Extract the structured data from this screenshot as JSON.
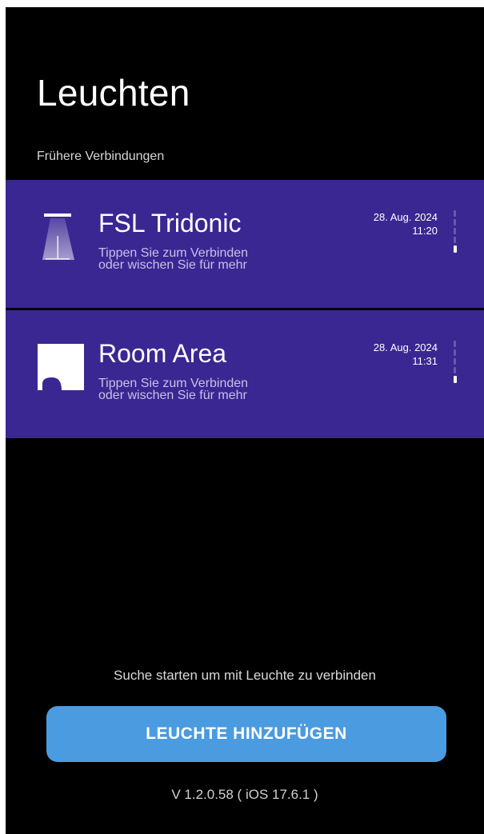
{
  "header": {
    "title": "Leuchten",
    "section_label": "Frühere Verbindungen"
  },
  "connections": [
    {
      "name": "FSL Tridonic",
      "icon": "ceiling-lamp-icon",
      "hint": "Tippen Sie zum Verbinden\noder wischen Sie für mehr",
      "date": "28. Aug. 2024",
      "time": "11:20"
    },
    {
      "name": "Room Area",
      "icon": "room-area-icon",
      "hint": "Tippen Sie zum Verbinden\noder wischen Sie für mehr",
      "date": "28. Aug. 2024",
      "time": "11:31"
    }
  ],
  "footer": {
    "search_hint": "Suche starten um mit Leuchte zu verbinden",
    "add_button_label": "LEUCHTE HINZUFÜGEN",
    "version": "V 1.2.0.58 ( iOS 17.6.1 )"
  },
  "colors": {
    "background": "#000000",
    "card": "#3a2792",
    "button": "#4a9be0",
    "text": "#ffffff"
  }
}
